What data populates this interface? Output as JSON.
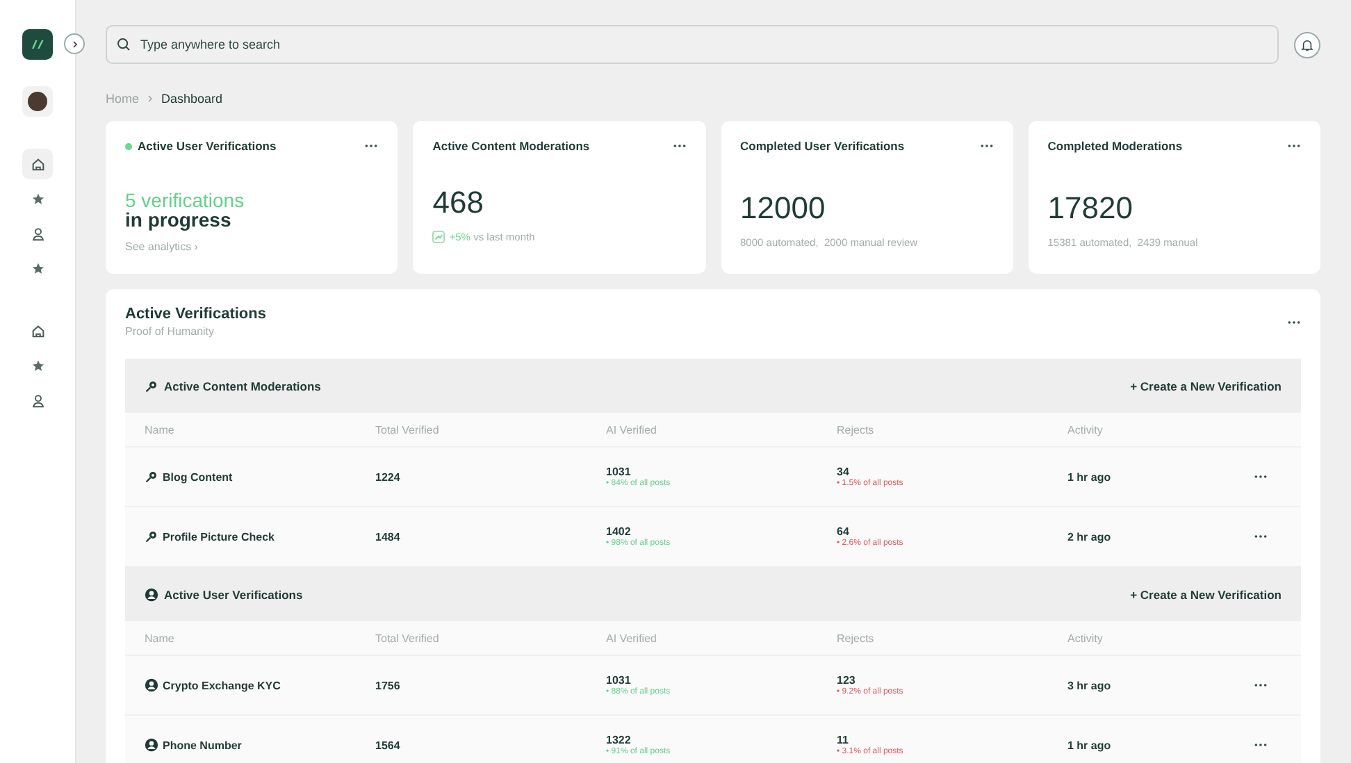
{
  "sidebar": {
    "items": [
      {
        "kind": "home",
        "selected": true
      },
      {
        "kind": "star",
        "selected": false
      },
      {
        "kind": "user",
        "selected": false
      },
      {
        "kind": "star",
        "selected": false
      }
    ],
    "bottom_items": [
      {
        "kind": "home",
        "selected": false
      },
      {
        "kind": "star",
        "selected": false
      },
      {
        "kind": "user",
        "selected": false
      }
    ]
  },
  "search": {
    "placeholder": "Type anywhere to search"
  },
  "breadcrumb": [
    "Home",
    "Dashboard"
  ],
  "cards": [
    {
      "kind": "progress",
      "title": "Active User Verifications",
      "highlight": "5 verifications",
      "value": "in progress",
      "link": "See analytics ›"
    },
    {
      "kind": "trend",
      "title": "Active Content Moderations",
      "value": "468",
      "change": "+5%",
      "note": "vs last month"
    },
    {
      "kind": "total",
      "title": "Completed User Verifications",
      "value": "12000",
      "note": "8000 automated,  2000 manual review"
    },
    {
      "kind": "total",
      "title": "Completed Moderations",
      "value": "17820",
      "note": "15381 automated,  2439 manual"
    }
  ],
  "panel": {
    "title": "Active Verifications",
    "subtitle": "Proof of Humanity",
    "groups": [
      {
        "kind": "content",
        "title": "Active Content Moderations",
        "action": "+ Create a New Verification",
        "columns": [
          "Name",
          "Total Verified",
          "AI Verified",
          "Rejects",
          "Activity"
        ],
        "rows": [
          {
            "name": "Blog Content",
            "total": "1224",
            "ai": "1031",
            "ai_share": "• 84% of all posts",
            "rejects": "34",
            "rejects_share": "• 1.5% of all posts",
            "activity": "1 hr ago"
          },
          {
            "name": "Profile Picture Check",
            "total": "1484",
            "ai": "1402",
            "ai_share": "• 98% of all posts",
            "rejects": "64",
            "rejects_share": "• 2.6% of all posts",
            "activity": "2 hr ago"
          }
        ]
      },
      {
        "kind": "user",
        "title": "Active User Verifications",
        "action": "+ Create a New Verification",
        "columns": [
          "Name",
          "Total Verified",
          "AI Verified",
          "Rejects",
          "Activity"
        ],
        "rows": [
          {
            "name": "Crypto Exchange KYC",
            "total": "1756",
            "ai": "1031",
            "ai_share": "• 88% of all  posts",
            "rejects": "123",
            "rejects_share": "• 9.2% of all posts",
            "activity": "3 hr ago"
          },
          {
            "name": "Phone Number",
            "total": "1564",
            "ai": "1322",
            "ai_share": "• 91% of all posts",
            "rejects": "11",
            "rejects_share": "• 3.1% of all posts",
            "activity": "1 hr ago"
          }
        ]
      }
    ]
  }
}
